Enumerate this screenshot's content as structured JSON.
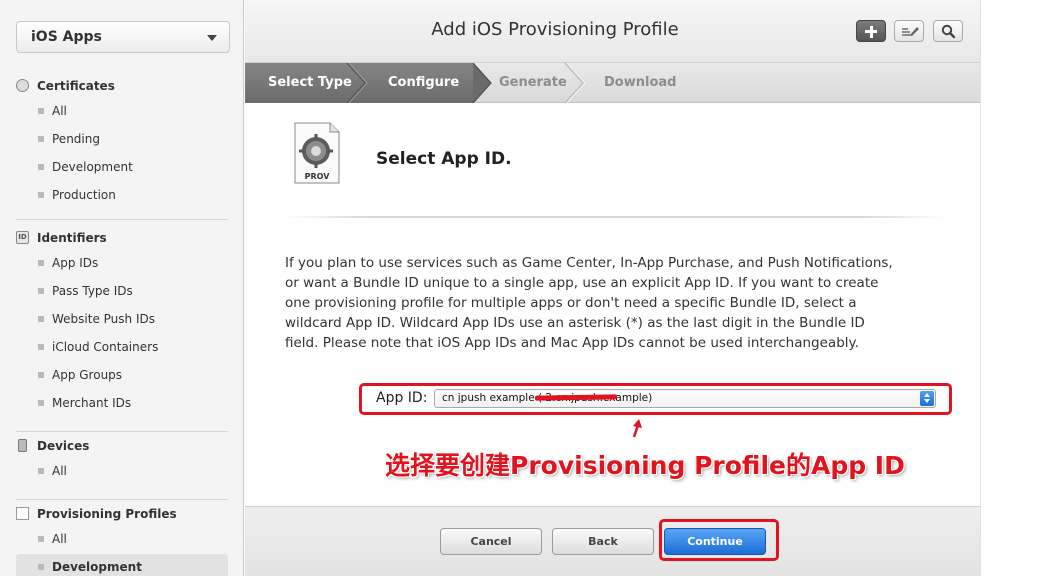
{
  "sidebar": {
    "platform": "iOS Apps",
    "sections": [
      {
        "title": "Certificates",
        "icon": "certificate-icon",
        "items": [
          "All",
          "Pending",
          "Development",
          "Production"
        ]
      },
      {
        "title": "Identifiers",
        "icon": "id-badge-icon",
        "icon_text": "ID",
        "items": [
          "App IDs",
          "Pass Type IDs",
          "Website Push IDs",
          "iCloud Containers",
          "App Groups",
          "Merchant IDs"
        ]
      },
      {
        "title": "Devices",
        "icon": "device-icon",
        "items": [
          "All"
        ]
      },
      {
        "title": "Provisioning Profiles",
        "icon": "profile-document-icon",
        "items": [
          "All",
          "Development"
        ]
      }
    ],
    "active_item": "Development"
  },
  "header": {
    "title": "Add iOS Provisioning Profile",
    "buttons": [
      "plus-icon",
      "edit-icon",
      "search-icon"
    ]
  },
  "steps": {
    "items": [
      "Select Type",
      "Configure",
      "Generate",
      "Download"
    ],
    "completed_count": 2
  },
  "content": {
    "icon_label": "PROV",
    "section_title": "Select App ID.",
    "description": "If you plan to use services such as Game Center, In-App Purchase, and Push Notifications, or want a Bundle ID unique to a single app, use an explicit App ID. If you want to create one provisioning profile for multiple apps or don't need a specific Bundle ID, select a wildcard App ID. Wildcard App IDs use an asterisk (*) as the last digit in the Bundle ID field. Please note that iOS App IDs and Mac App IDs cannot be used interchangeably.",
    "app_id_label": "App ID:",
    "app_id_value": "cn jpush example (                2.cn.jpush.example)",
    "annotation": "选择要创建Provisioning Profile的App ID"
  },
  "footer": {
    "cancel": "Cancel",
    "back": "Back",
    "continue": "Continue"
  },
  "colors": {
    "highlight_red": "#e0141e",
    "primary_blue": "#1c6dd6",
    "step_active_bg": "#6b6b6b"
  }
}
